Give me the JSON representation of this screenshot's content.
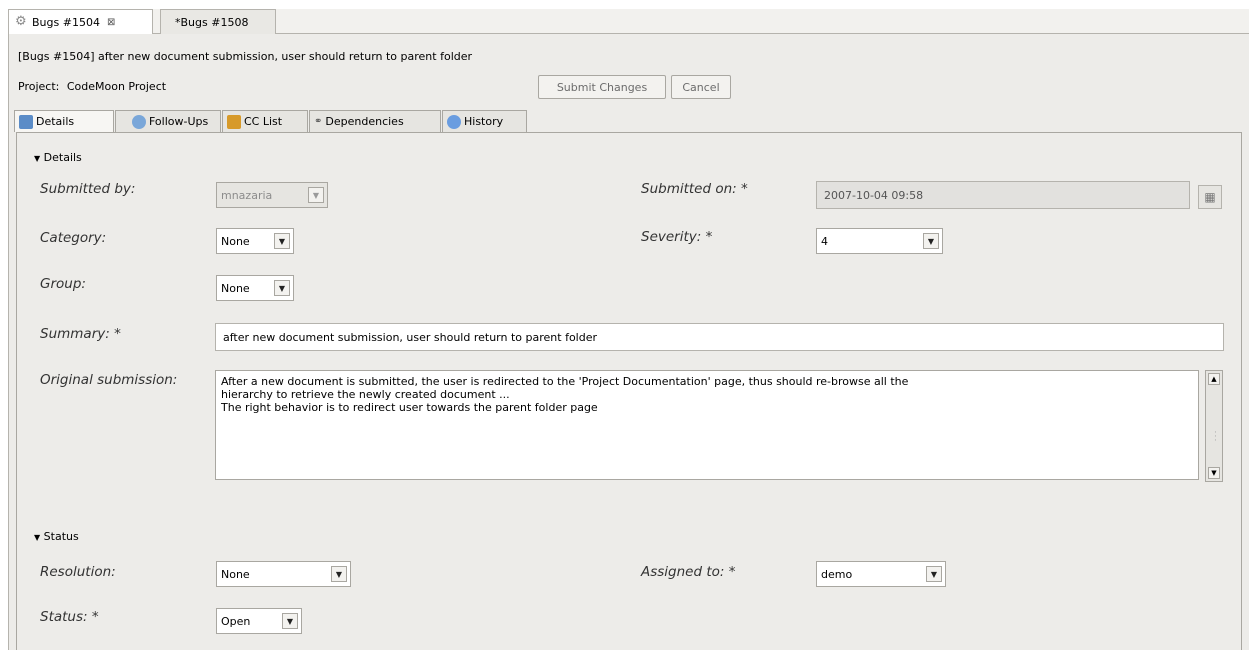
{
  "editor_tabs": [
    {
      "label": "Bugs #1504",
      "active": true
    },
    {
      "label": "*Bugs #1508",
      "active": false
    }
  ],
  "header": {
    "title": "[Bugs #1504] after new document submission, user should return to parent folder",
    "project_label": "Project:",
    "project_value": "CodeMoon Project",
    "submit_label": "Submit Changes",
    "cancel_label": "Cancel"
  },
  "page_tabs": [
    {
      "label": "Details"
    },
    {
      "label": "Follow-Ups"
    },
    {
      "label": "CC List"
    },
    {
      "label": "Dependencies"
    },
    {
      "label": "History"
    }
  ],
  "details": {
    "section_title": "Details",
    "submitted_by_label": "Submitted by:",
    "submitted_by_value": "mnazaria",
    "submitted_on_label": "Submitted on: *",
    "submitted_on_value": "2007-10-04 09:58",
    "category_label": "Category:",
    "category_value": "None",
    "severity_label": "Severity: *",
    "severity_value": "4",
    "group_label": "Group:",
    "group_value": "None",
    "summary_label": "Summary: *",
    "summary_value": "after new document submission, user should return to parent folder",
    "original_label": "Original submission:",
    "original_line1": "After a new document is submitted, the user is redirected to the 'Project Documentation' page, thus should re-browse all the",
    "original_line2": "hierarchy to retrieve the newly created document ...",
    "original_line3": "The right behavior is to redirect user towards the parent folder page"
  },
  "status": {
    "section_title": "Status",
    "resolution_label": "Resolution:",
    "resolution_value": "None",
    "assigned_label": "Assigned to: *",
    "assigned_value": "demo",
    "status_label": "Status: *",
    "status_value": "Open"
  },
  "colors": {
    "details_icon": "#5b8cc7",
    "followups_icon": "#7aa7d9",
    "cclist_icon": "#d79a2a",
    "history_icon": "#6a9de0"
  }
}
